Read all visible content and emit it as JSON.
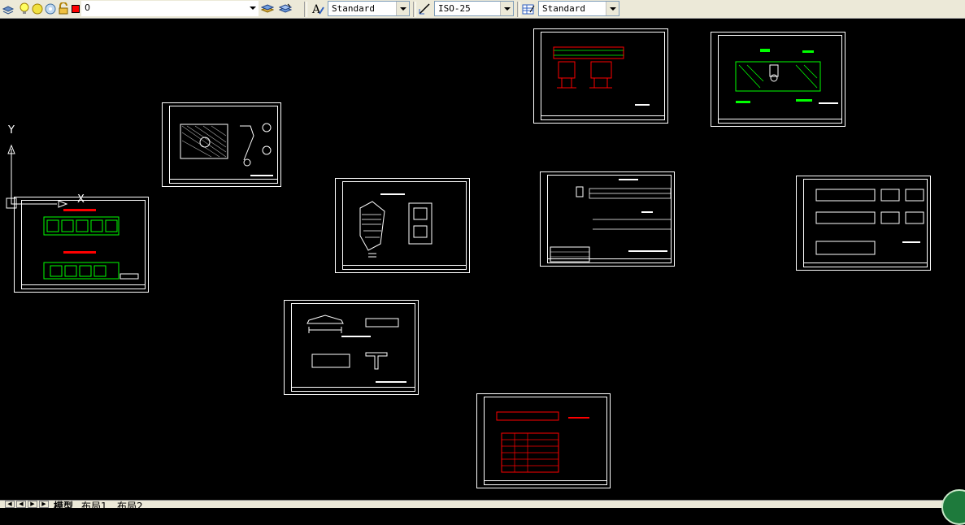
{
  "toolbar": {
    "layer_name": "0",
    "text_style": "Standard",
    "dim_style": "ISO-25",
    "table_style": "Standard",
    "icons": [
      "layer-stack-icon",
      "lightbulb-icon",
      "sun-icon",
      "freeze-icon",
      "lock-icon",
      "color-swatch-icon",
      "layer-manager-icon",
      "layer-previous-icon",
      "text-style-icon",
      "dim-style-icon",
      "table-style-icon"
    ],
    "layer_color": "#ff0000"
  },
  "ucs": {
    "y_label": "Y",
    "x_label": "X"
  },
  "tabs": {
    "model": "模型",
    "layout1": "布局1",
    "layout2": "布局2"
  },
  "colors": {
    "background": "#000000",
    "red": "#ff0000",
    "green": "#00ff00",
    "white": "#ffffff"
  }
}
